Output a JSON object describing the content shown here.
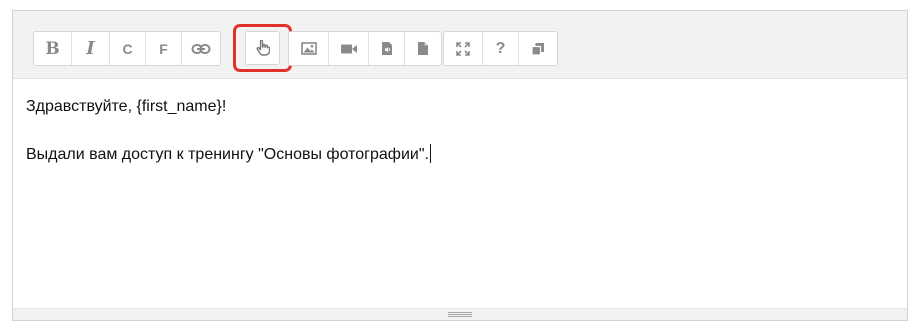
{
  "toolbar": {
    "buttons": {
      "bold": "B",
      "italic": "I",
      "c": "C",
      "f": "F",
      "help": "?"
    },
    "icons": [
      "bold-icon",
      "italic-icon",
      "link-icon",
      "pointer-hand-icon",
      "image-icon",
      "video-icon",
      "audio-file-icon",
      "file-icon",
      "fullscreen-icon",
      "help-icon",
      "copy-icon"
    ],
    "highlight_color": "#e0312b"
  },
  "content": {
    "line1": "Здравствуйте, {first_name}!",
    "line2": "Выдали вам доступ к тренингу \"Основы фотографии\"."
  }
}
